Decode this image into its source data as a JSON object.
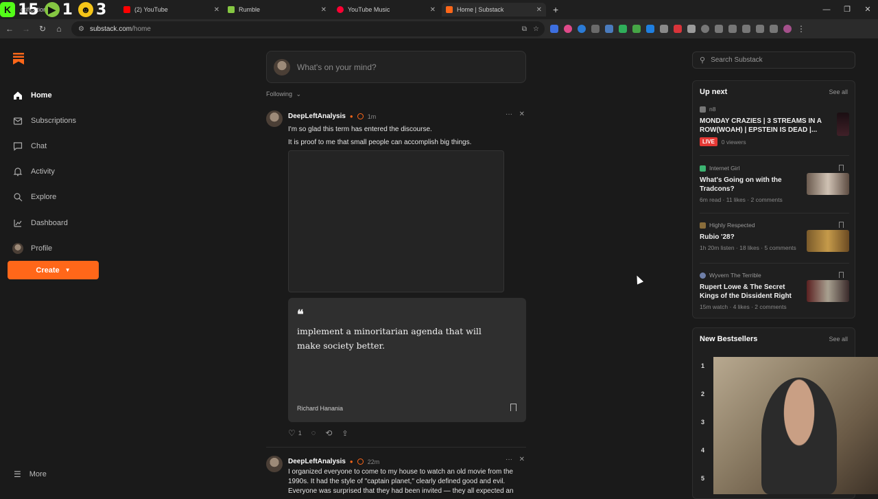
{
  "browser": {
    "tabs": [
      {
        "label": "otifications / X"
      },
      {
        "label": "(2) YouTube"
      },
      {
        "label": "Rumble"
      },
      {
        "label": "YouTube Music"
      },
      {
        "label": "Home | Substack"
      }
    ],
    "stream_overlay": {
      "kick": "15",
      "rumble": "1",
      "youtube": "3"
    },
    "url_host": "substack.com",
    "url_path": "/home",
    "new_tab": "+"
  },
  "sidebar": {
    "items": [
      {
        "label": "Home"
      },
      {
        "label": "Subscriptions"
      },
      {
        "label": "Chat"
      },
      {
        "label": "Activity"
      },
      {
        "label": "Explore"
      },
      {
        "label": "Dashboard"
      },
      {
        "label": "Profile"
      }
    ],
    "create_label": "Create",
    "more_label": "More"
  },
  "feed": {
    "composer_placeholder": "What's on your mind?",
    "filter_label": "Following",
    "posts": [
      {
        "author": "DeepLeftAnalysis",
        "time": "1m",
        "lines": [
          "I'm so glad this term has entered the discourse.",
          "It is proof to me that small people can accomplish big things."
        ],
        "quote_text": "implement a minoritarian agenda that will make society better.",
        "quote_author": "Richard Hanania",
        "likes": "1"
      },
      {
        "author": "DeepLeftAnalysis",
        "time": "22m",
        "lines": [
          "I organized everyone to come to my house to watch an old movie from the 1990s. It had the style of \"captain planet,\" clearly defined good and evil. Everyone was surprised that they had been invited — they all expected an"
        ]
      }
    ]
  },
  "right": {
    "search_placeholder": "Search Substack",
    "up_next": {
      "title": "Up next",
      "see_all": "See all",
      "items": [
        {
          "pub": "n8",
          "title": "MONDAY CRAZIES | 3 STREAMS IN A ROW(WOAH) | EPSTEIN IS DEAD |...",
          "live": "LIVE",
          "meta": "0 viewers"
        },
        {
          "pub": "Internet Girl",
          "title": "What's Going on with the Tradcons?",
          "meta": "6m read · 11 likes · 2 comments"
        },
        {
          "pub": "Highly Respected",
          "title": "Rubio '28?",
          "meta": "1h 20m listen · 18 likes · 5 comments"
        },
        {
          "pub": "Wyvern The Terrible",
          "title": "Rupert Lowe & The Secret Kings of the Dissident Right",
          "meta": "15m watch · 4 likes · 2 comments"
        }
      ]
    },
    "bestsellers": {
      "title": "New Bestsellers",
      "see_all": "See all",
      "ranks": [
        "1",
        "2",
        "3",
        "4",
        "5"
      ]
    }
  },
  "colors": {
    "accent": "#ff6719",
    "background": "#1a1a1a",
    "live": "#e53935"
  }
}
